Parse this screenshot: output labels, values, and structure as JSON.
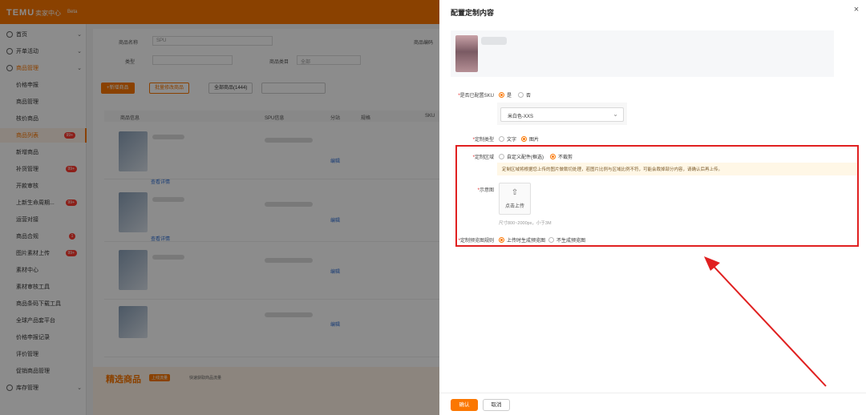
{
  "app": {
    "logo": "TEMU",
    "seller_center": "卖家中心",
    "beta": "Beta",
    "sidebar": [
      {
        "label": "首页",
        "kind": "top"
      },
      {
        "label": "开单活动",
        "kind": "top"
      },
      {
        "label": "商品管理",
        "kind": "top-active"
      },
      {
        "label": "价格申报",
        "kind": "sub"
      },
      {
        "label": "商品管理",
        "kind": "sub"
      },
      {
        "label": "核价商品",
        "kind": "sub"
      },
      {
        "label": "商品列表",
        "kind": "sub-active",
        "badge": "99+"
      },
      {
        "label": "新增商品",
        "kind": "sub"
      },
      {
        "label": "补货管理",
        "kind": "sub",
        "badge": "99+"
      },
      {
        "label": "开款审核",
        "kind": "sub"
      },
      {
        "label": "上新生命周期...",
        "kind": "sub",
        "badge": "99+"
      },
      {
        "label": "运营对接",
        "kind": "sub"
      },
      {
        "label": "商品合规",
        "kind": "sub",
        "dot": "1"
      },
      {
        "label": "图片素材上传",
        "kind": "sub",
        "badge": "99+"
      },
      {
        "label": "素材中心",
        "kind": "sub"
      },
      {
        "label": "素材审核工具",
        "kind": "sub"
      },
      {
        "label": "商品条码下载工具",
        "kind": "sub"
      },
      {
        "label": "全球产品套平台",
        "kind": "sub"
      },
      {
        "label": "价格申报记录",
        "kind": "sub"
      },
      {
        "label": "评价管理",
        "kind": "sub"
      },
      {
        "label": "促销商品管理",
        "kind": "sub"
      },
      {
        "label": "库存管理",
        "kind": "top"
      }
    ],
    "filters": {
      "name_label": "商品名称",
      "name_value": "SPU",
      "type_label": "类型",
      "category_label": "商品类目",
      "category_value": "全部",
      "code_label": "商品编码"
    },
    "toolbar": {
      "add": "+新增商品",
      "batch": "批量修改商品",
      "total": "全部商品(1444)"
    },
    "table_headers": [
      "商品信息",
      "SPU信息",
      "分站",
      "规格",
      "SKU"
    ],
    "row_link": "查看详情",
    "row_action": "编辑",
    "promo": {
      "title": "精选商品",
      "tag": "上线流量",
      "text": "快速获取商品流量"
    }
  },
  "drawer": {
    "title": "配置定制内容",
    "close": "×",
    "form": {
      "sku_label": "是否已配置SKU",
      "sku_options": [
        "是",
        "否"
      ],
      "sku_selected": 0,
      "sku_select_value": "米白色-XXS",
      "type_label": "定制类型",
      "type_options": [
        "文字",
        "图片"
      ],
      "type_selected": 1,
      "area_label": "定制区域",
      "area_options": [
        "自定义配件(框选)",
        "不裁剪"
      ],
      "area_selected": 1,
      "tip": "定制区域将根据您上传的图片做裁切处理，若图片比例与区域比例不符，可能会裁掉部分内容，请确认后再上传。",
      "image_label": "示意图",
      "upload_text": "点击上传",
      "upload_hint": "尺寸800~2000px，小于3M",
      "preview_label": "定制预览图规则",
      "preview_options": [
        "上传时生成预览图",
        "不生成预览图"
      ],
      "preview_selected": 0
    },
    "footer": {
      "confirm": "确认",
      "cancel": "取消"
    }
  },
  "colors": {
    "accent": "#fb7701",
    "highlight_box": "#e02020"
  }
}
